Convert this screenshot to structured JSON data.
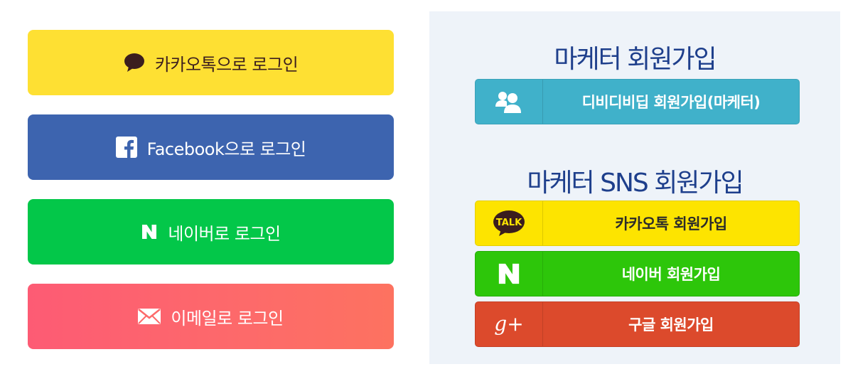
{
  "login": {
    "kakao": {
      "label": "카카오톡으로 로그인",
      "icon": "speech-bubble-icon",
      "color": "#fee033"
    },
    "facebook": {
      "label": "Facebook으로 로그인",
      "icon": "facebook-icon",
      "color": "#3d64af"
    },
    "naver": {
      "label": "네이버로 로그인",
      "icon": "naver-icon",
      "color": "#03c749"
    },
    "email": {
      "label": "이메일로 로그인",
      "icon": "envelope-icon",
      "color": "#fd6a6a"
    }
  },
  "panel": {
    "title_marketer": "마케터 회원가입",
    "title_sns": "마케터 SNS 회원가입",
    "marketer_join": {
      "label": "디비디비딥 회원가입(마케터)",
      "icon": "user-group-icon",
      "color": "#40b1ca"
    },
    "kakao_join": {
      "label": "카카오톡 회원가입",
      "icon": "kakaotalk-icon",
      "icon_text": "TALK",
      "color": "#fde400"
    },
    "naver_join": {
      "label": "네이버 회원가입",
      "icon": "naver-icon",
      "color": "#2dc60a"
    },
    "google_join": {
      "label": "구글 회원가입",
      "icon": "google-plus-icon",
      "icon_text": "g+",
      "color": "#dc4a2c"
    }
  }
}
